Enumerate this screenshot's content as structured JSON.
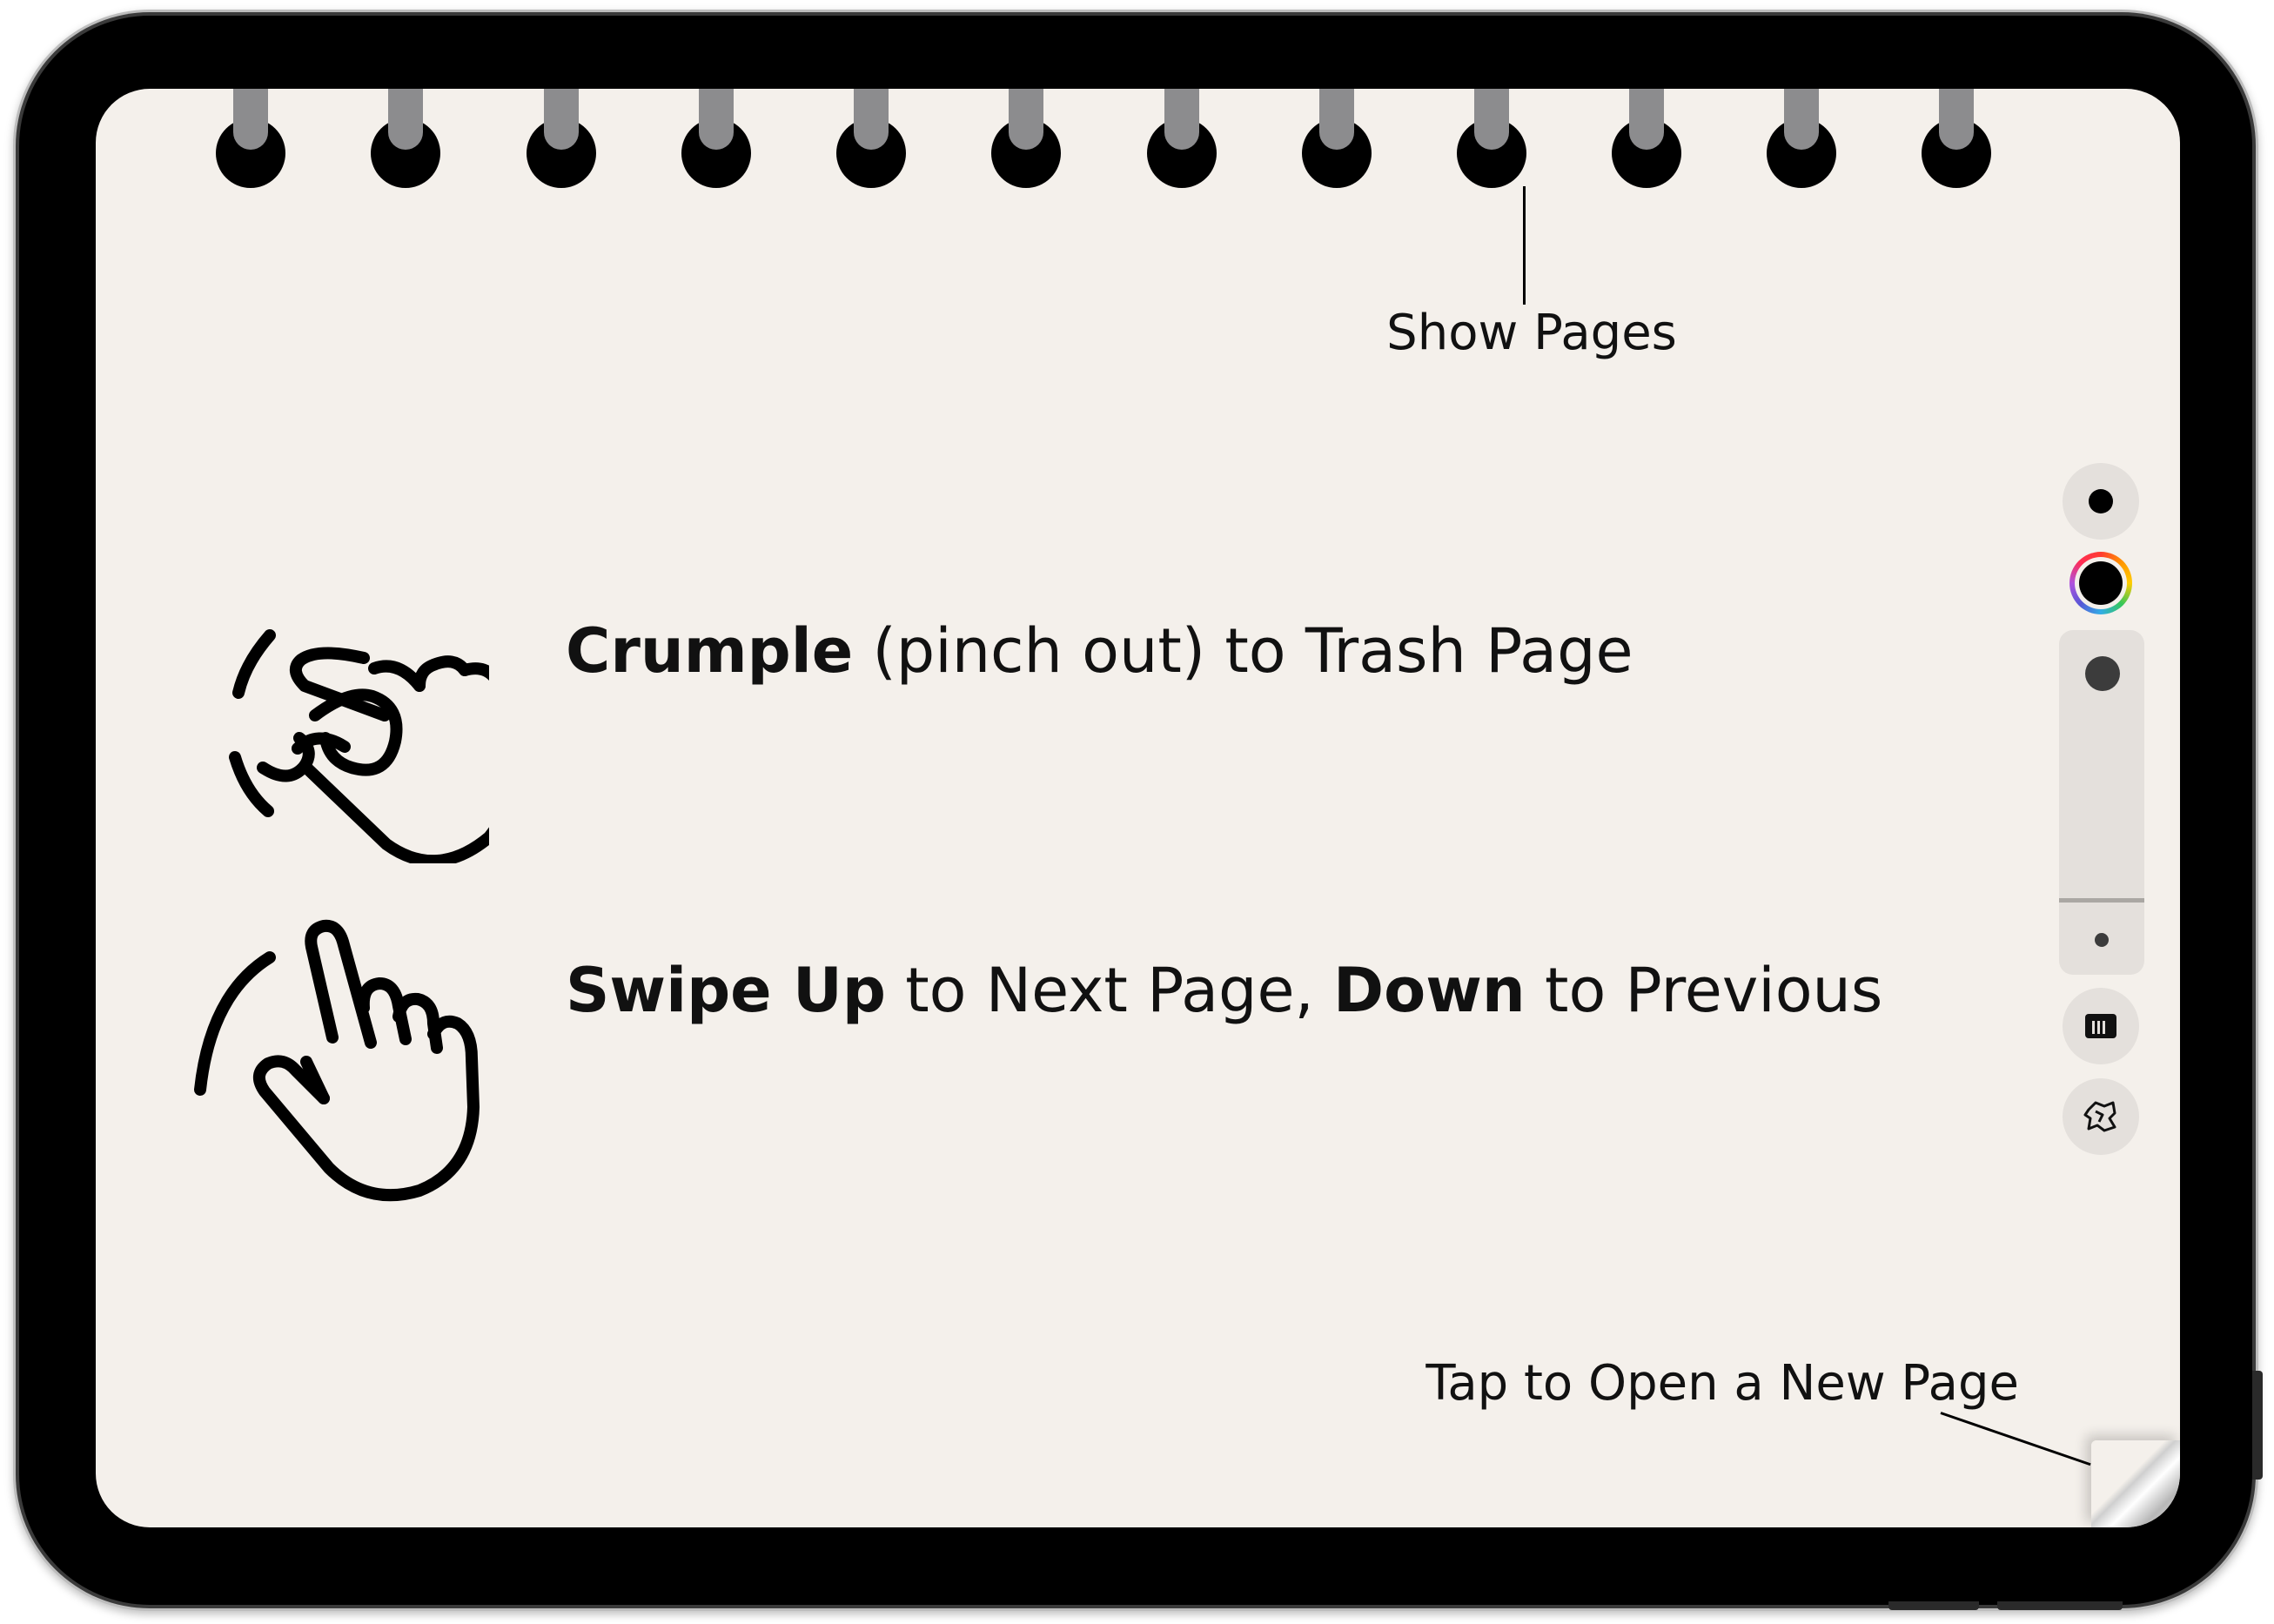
{
  "callouts": {
    "show_pages": "Show Pages",
    "new_page": "Tap to Open a New Page"
  },
  "instructions": {
    "crumple": {
      "bold": "Crumple",
      "rest": " (pinch out) to Trash Page",
      "icon": "crumple-hand-icon"
    },
    "swipe": {
      "bold1": "Swipe Up",
      "mid": " to Next Page, ",
      "bold2": "Down",
      "rest": " to Previous",
      "icon": "swipe-hand-icon"
    }
  },
  "toolbar": {
    "pen_color": "#000000",
    "icons": [
      "pen-size-icon",
      "color-picker-icon",
      "size-slider",
      "notebook-icon",
      "crumple-icon"
    ]
  },
  "colors": {
    "page": "#f4f0eb",
    "ring_bar": "#8c8c8e",
    "device": "#000000"
  }
}
